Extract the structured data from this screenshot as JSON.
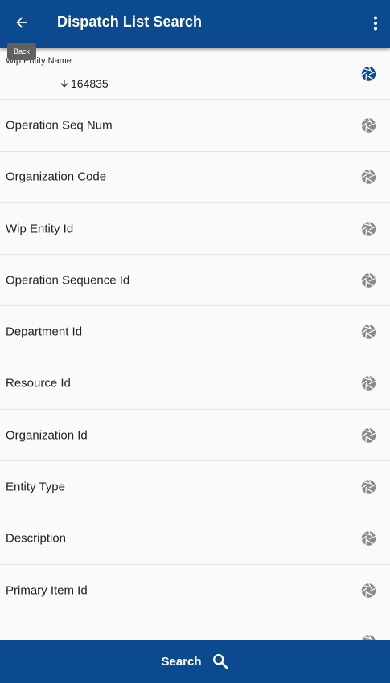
{
  "header": {
    "title": "Dispatch List Search",
    "back_tooltip": "Back",
    "back_icon": "arrow-left-icon",
    "menu_icon": "more-vert-icon"
  },
  "fields": [
    {
      "label": "Wip Entity Name",
      "value": "164835",
      "sort_icon": "arrow-down-icon",
      "active": true
    },
    {
      "label": "Operation Seq Num"
    },
    {
      "label": "Organization Code"
    },
    {
      "label": "Wip Entity Id"
    },
    {
      "label": "Operation Sequence Id"
    },
    {
      "label": "Department Id"
    },
    {
      "label": "Resource Id"
    },
    {
      "label": "Organization Id"
    },
    {
      "label": "Entity Type"
    },
    {
      "label": "Description"
    },
    {
      "label": "Primary Item Id"
    }
  ],
  "footer": {
    "search_label": "Search",
    "search_icon": "search-icon"
  },
  "colors": {
    "primary": "#0b4a91",
    "icon_active": "#0b4a91",
    "icon_inactive": "#8a8a8a"
  }
}
